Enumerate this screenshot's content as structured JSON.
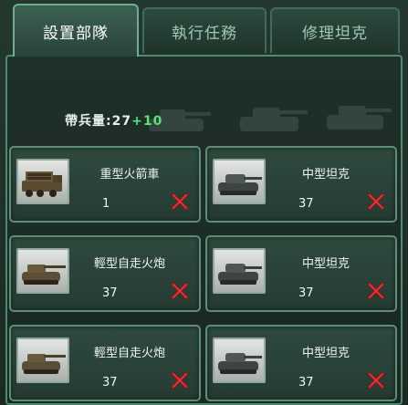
{
  "tabs": [
    {
      "label": "設置部隊",
      "active": true
    },
    {
      "label": "執行任務",
      "active": false
    },
    {
      "label": "修理坦克",
      "active": false
    }
  ],
  "capacity": {
    "label": "帶兵量:",
    "base": "27",
    "bonus": "+10"
  },
  "units": [
    {
      "name": "重型火箭車",
      "count": "1",
      "icon": "rocket-truck-icon"
    },
    {
      "name": "中型坦克",
      "count": "37",
      "icon": "medium-tank-icon"
    },
    {
      "name": "輕型自走火炮",
      "count": "37",
      "icon": "self-propelled-gun-icon"
    },
    {
      "name": "中型坦克",
      "count": "37",
      "icon": "medium-tank-icon"
    },
    {
      "name": "輕型自走火炮",
      "count": "37",
      "icon": "self-propelled-gun-icon"
    },
    {
      "name": "中型坦克",
      "count": "37",
      "icon": "medium-tank-icon"
    }
  ],
  "colors": {
    "accent_green": "#5be07a",
    "remove_red": "#e0383c",
    "border": "#5c8f78"
  }
}
